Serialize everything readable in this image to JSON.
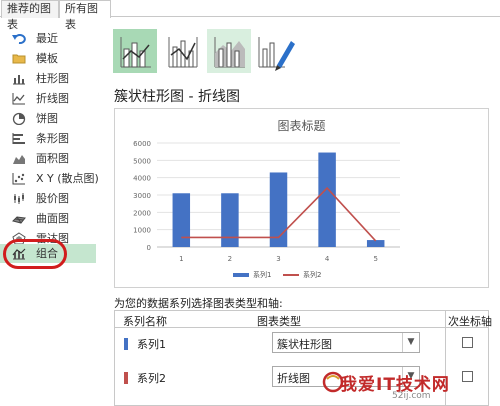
{
  "tabs": [
    {
      "label": "推荐的图表"
    },
    {
      "label": "所有图表"
    }
  ],
  "nav": {
    "items": [
      {
        "label": "最近",
        "icon": "undo-arrow-icon"
      },
      {
        "label": "模板",
        "icon": "folder-icon"
      },
      {
        "label": "柱形图",
        "icon": "column-chart-icon"
      },
      {
        "label": "折线图",
        "icon": "line-chart-icon"
      },
      {
        "label": "饼图",
        "icon": "pie-chart-icon"
      },
      {
        "label": "条形图",
        "icon": "bar-chart-icon"
      },
      {
        "label": "面积图",
        "icon": "area-chart-icon"
      },
      {
        "label": "X Y (散点图)",
        "icon": "scatter-chart-icon"
      },
      {
        "label": "股价图",
        "icon": "stock-chart-icon"
      },
      {
        "label": "曲面图",
        "icon": "surface-chart-icon"
      },
      {
        "label": "雷达图",
        "icon": "radar-chart-icon"
      },
      {
        "label": "组合",
        "icon": "combo-chart-icon"
      }
    ],
    "selected_index": 11
  },
  "main": {
    "heading": "簇状柱形图 - 折线图",
    "preview_title": "图表标题",
    "prompt": "为您的数据系列选择图表类型和轴:",
    "grid_headers": {
      "name": "系列名称",
      "type": "图表类型",
      "secondary": "次坐标轴"
    },
    "series_rows": [
      {
        "name": "系列1",
        "color": "#4472c4",
        "chart_type": "簇状柱形图",
        "secondary": false
      },
      {
        "name": "系列2",
        "color": "#c0504d",
        "chart_type": "折线图",
        "secondary": false
      }
    ]
  },
  "chart_data": {
    "type": "bar",
    "title": "图表标题",
    "categories": [
      "1",
      "2",
      "3",
      "4",
      "5"
    ],
    "ylim": [
      0,
      6000
    ],
    "yticks": [
      0,
      1000,
      2000,
      3000,
      4000,
      5000,
      6000
    ],
    "series": [
      {
        "name": "系列1",
        "type": "bar",
        "color": "#4472c4",
        "values": [
          3100,
          3100,
          4300,
          5450,
          400
        ]
      },
      {
        "name": "系列2",
        "type": "line",
        "color": "#c0504d",
        "values": [
          550,
          550,
          550,
          3400,
          350
        ]
      }
    ],
    "legend": "bottom",
    "grid": true
  },
  "watermark": {
    "text": "我爱IT技术网",
    "sub": "52ij.com"
  }
}
